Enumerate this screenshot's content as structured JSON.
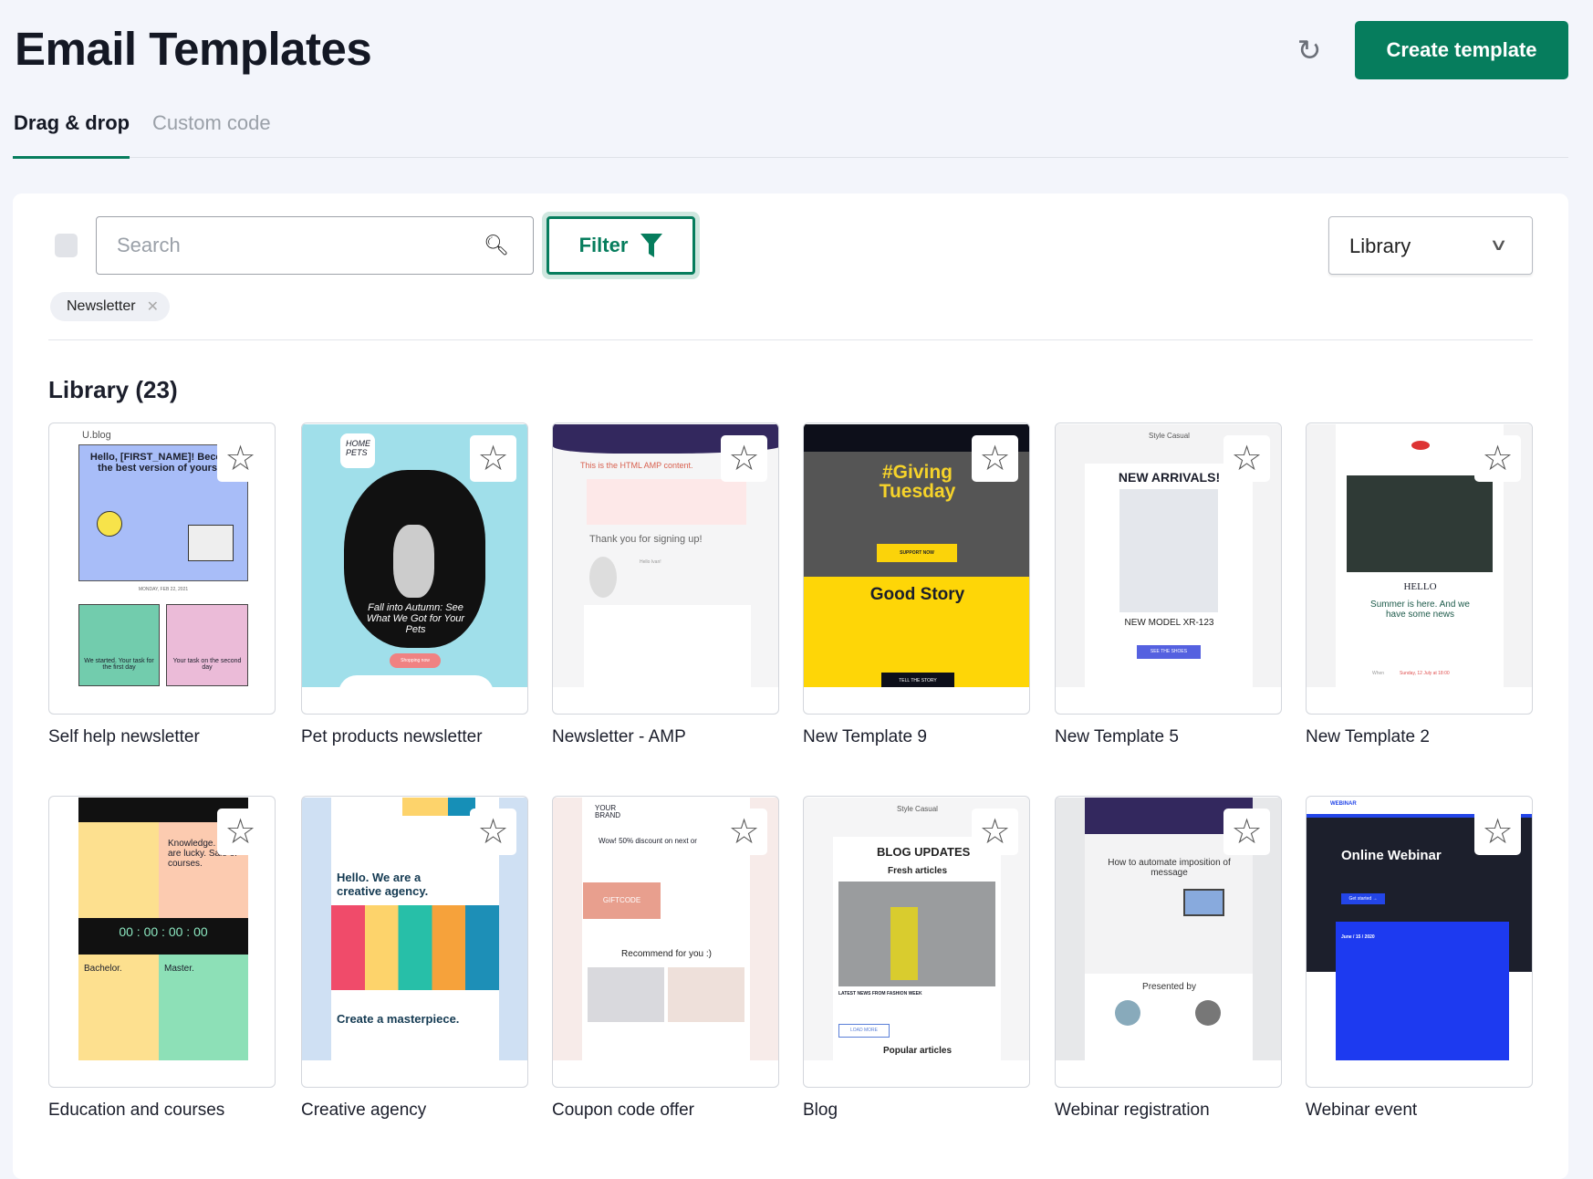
{
  "header": {
    "title": "Email Templates",
    "create_label": "Create template",
    "refresh_icon": "refresh-icon"
  },
  "tabs": [
    {
      "label": "Drag & drop",
      "active": true
    },
    {
      "label": "Custom code",
      "active": false
    }
  ],
  "toolbar": {
    "search_placeholder": "Search",
    "search_value": "",
    "filter_label": "Filter",
    "source_select": "Library"
  },
  "active_filters": [
    {
      "label": "Newsletter"
    }
  ],
  "section_title": "Library (23)",
  "colors": {
    "accent": "#067d5d"
  },
  "templates": [
    {
      "name": "Self help newsletter",
      "thumb": {
        "brand": "U.blog",
        "headline": "Hello, [FIRST_NAME]! Become the best version of yourself",
        "date": "MONDAY, FEB 22, 2021",
        "box1": "We started. Your task for the first day",
        "box2": "Your task on the second day"
      }
    },
    {
      "name": "Pet products newsletter",
      "thumb": {
        "brand": "HOME PETS",
        "headline": "Fall into Autumn: See What We Got for Your Pets",
        "cta": "Shopping now"
      }
    },
    {
      "name": "Newsletter - AMP",
      "thumb": {
        "note": "This is the HTML AMP content.",
        "headline": "Thank you for signing up!",
        "greeting": "Hello Ivan!"
      }
    },
    {
      "name": "New Template 9",
      "thumb": {
        "headline": "#Giving Tuesday",
        "cta": "SUPPORT NOW",
        "headline2": "Good Story",
        "cta2": "TELL THE STORY"
      }
    },
    {
      "name": "New Template 5",
      "thumb": {
        "brand": "Style Casual",
        "headline": "NEW ARRIVALS!",
        "model": "NEW MODEL XR-123",
        "cta": "SEE THE SHOES"
      }
    },
    {
      "name": "New Template 2",
      "thumb": {
        "greeting": "HELLO",
        "headline": "Summer is here. And we have some news",
        "when_label": "When",
        "when": "Sunday, 12 July at 18:00"
      }
    },
    {
      "name": "Education and courses",
      "thumb": {
        "headline": "Knowledge. You are lucky. Sale of courses.",
        "timer": "00 : 00 : 00 : 00",
        "b1": "Bachelor.",
        "b2": "Master."
      }
    },
    {
      "name": "Creative agency",
      "thumb": {
        "headline": "Hello. We are a creative agency.",
        "headline2": "Create a masterpiece."
      }
    },
    {
      "name": "Coupon code offer",
      "thumb": {
        "brand": "YOUR BRAND",
        "headline": "Wow! 50% discount on next or",
        "code": "GIFTCODE",
        "rec": "Recommend for you :)"
      }
    },
    {
      "name": "Blog",
      "thumb": {
        "brand": "Style Casual",
        "headline": "BLOG UPDATES",
        "sub": "Fresh articles",
        "news": "LATEST NEWS FROM FASHION WEEK",
        "cta": "LOAD MORE",
        "popular": "Popular articles"
      }
    },
    {
      "name": "Webinar registration",
      "thumb": {
        "headline": "How to automate imposition of message",
        "presented": "Presented by"
      }
    },
    {
      "name": "Webinar event",
      "thumb": {
        "brand": "WEBINAR",
        "headline": "Online Webinar",
        "cta": "Get started →",
        "date": "June / 15 / 2020"
      }
    }
  ]
}
